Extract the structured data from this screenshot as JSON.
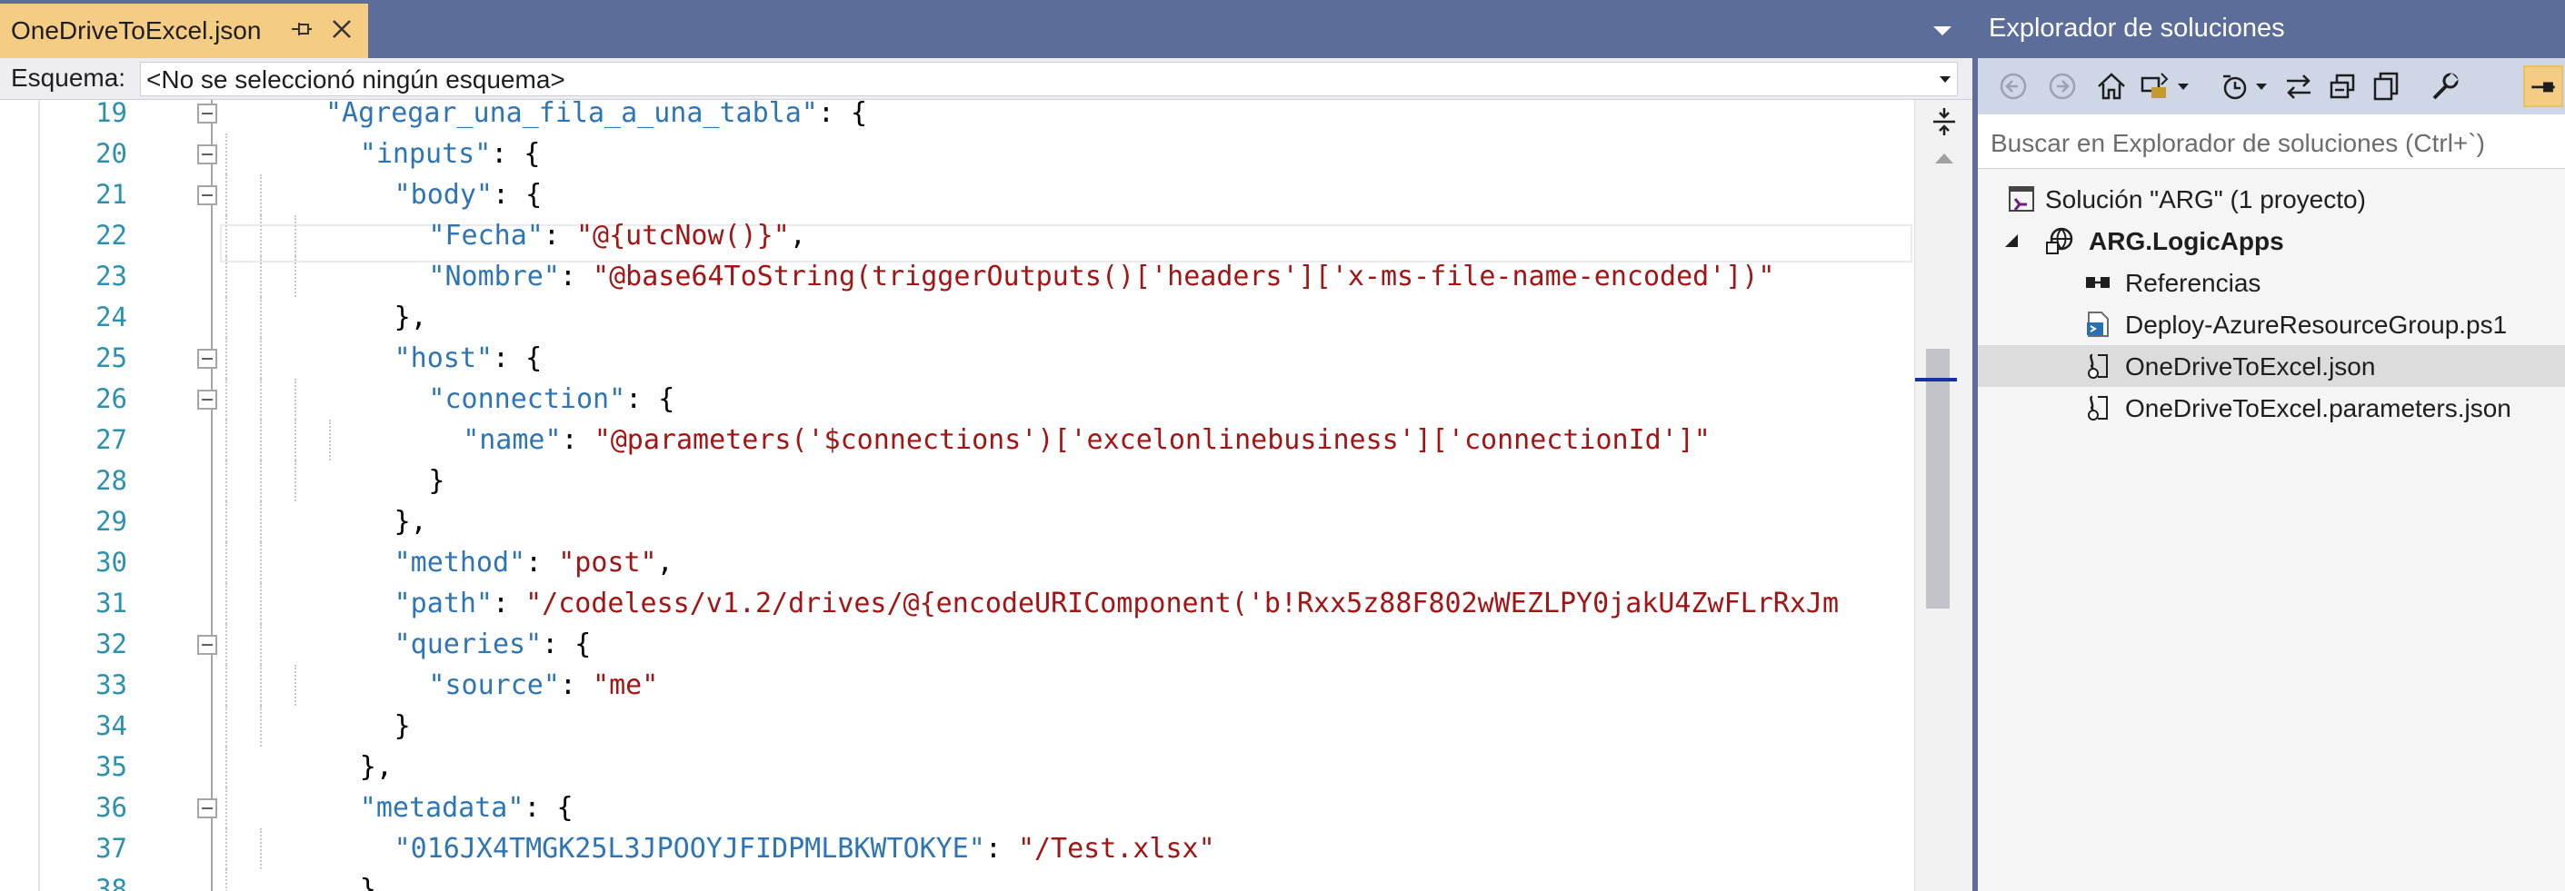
{
  "editor": {
    "tab": {
      "title": "OneDriveToExcel.json"
    },
    "schema": {
      "label": "Esquema:",
      "value": "<No se seleccionó ningún esquema>"
    },
    "lines": [
      {
        "number": "19",
        "tokens": [
          {
            "t": "k",
            "v": "\"Agregar_una_fila_a_una_tabla\""
          },
          {
            "t": "p",
            "v": ": {"
          }
        ]
      },
      {
        "number": "20",
        "tokens": [
          {
            "t": "k",
            "v": "\"inputs\""
          },
          {
            "t": "p",
            "v": ": {"
          }
        ]
      },
      {
        "number": "21",
        "tokens": [
          {
            "t": "k",
            "v": "\"body\""
          },
          {
            "t": "p",
            "v": ": {"
          }
        ]
      },
      {
        "number": "22",
        "tokens": [
          {
            "t": "k",
            "v": "\"Fecha\""
          },
          {
            "t": "p",
            "v": ": "
          },
          {
            "t": "s",
            "v": "\"@{utcNow()}\""
          },
          {
            "t": "p",
            "v": ","
          }
        ]
      },
      {
        "number": "23",
        "tokens": [
          {
            "t": "k",
            "v": "\"Nombre\""
          },
          {
            "t": "p",
            "v": ": "
          },
          {
            "t": "s",
            "v": "\"@base64ToString(triggerOutputs()['headers']['x-ms-file-name-encoded'])\""
          }
        ]
      },
      {
        "number": "24",
        "tokens": [
          {
            "t": "p",
            "v": "},"
          }
        ]
      },
      {
        "number": "25",
        "tokens": [
          {
            "t": "k",
            "v": "\"host\""
          },
          {
            "t": "p",
            "v": ": {"
          }
        ]
      },
      {
        "number": "26",
        "tokens": [
          {
            "t": "k",
            "v": "\"connection\""
          },
          {
            "t": "p",
            "v": ": {"
          }
        ]
      },
      {
        "number": "27",
        "tokens": [
          {
            "t": "k",
            "v": "\"name\""
          },
          {
            "t": "p",
            "v": ": "
          },
          {
            "t": "s",
            "v": "\"@parameters('$connections')['excelonlinebusiness']['connectionId']\""
          }
        ]
      },
      {
        "number": "28",
        "tokens": [
          {
            "t": "p",
            "v": "}"
          }
        ]
      },
      {
        "number": "29",
        "tokens": [
          {
            "t": "p",
            "v": "},"
          }
        ]
      },
      {
        "number": "30",
        "tokens": [
          {
            "t": "k",
            "v": "\"method\""
          },
          {
            "t": "p",
            "v": ": "
          },
          {
            "t": "s",
            "v": "\"post\""
          },
          {
            "t": "p",
            "v": ","
          }
        ]
      },
      {
        "number": "31",
        "tokens": [
          {
            "t": "k",
            "v": "\"path\""
          },
          {
            "t": "p",
            "v": ": "
          },
          {
            "t": "s",
            "v": "\"/codeless/v1.2/drives/@{encodeURIComponent('b!Rxx5z88F802wWEZLPY0jakU4ZwFLrRxJm"
          }
        ]
      },
      {
        "number": "32",
        "tokens": [
          {
            "t": "k",
            "v": "\"queries\""
          },
          {
            "t": "p",
            "v": ": {"
          }
        ]
      },
      {
        "number": "33",
        "tokens": [
          {
            "t": "k",
            "v": "\"source\""
          },
          {
            "t": "p",
            "v": ": "
          },
          {
            "t": "s",
            "v": "\"me\""
          }
        ]
      },
      {
        "number": "34",
        "tokens": [
          {
            "t": "p",
            "v": "}"
          }
        ]
      },
      {
        "number": "35",
        "tokens": [
          {
            "t": "p",
            "v": "},"
          }
        ]
      },
      {
        "number": "36",
        "tokens": [
          {
            "t": "k",
            "v": "\"metadata\""
          },
          {
            "t": "p",
            "v": ": {"
          }
        ]
      },
      {
        "number": "37",
        "tokens": [
          {
            "t": "k",
            "v": "\"016JX4TMGK25L3JPOOYJFIDPMLBKWTOKYE\""
          },
          {
            "t": "p",
            "v": ": "
          },
          {
            "t": "s",
            "v": "\"/Test.xlsx\""
          }
        ]
      },
      {
        "number": "38",
        "tokens": [
          {
            "t": "p",
            "v": "},"
          }
        ]
      }
    ]
  },
  "explorer": {
    "title": "Explorador de soluciones",
    "search_placeholder": "Buscar en Explorador de soluciones (Ctrl+`)",
    "toolbar_icons": [
      "back-icon",
      "forward-icon",
      "home-icon",
      "switch-views-icon",
      "dropdown-arrow-icon",
      "pending-changes-icon",
      "dropdown-arrow-icon",
      "sync-icon",
      "collapse-all-icon",
      "show-all-files-icon",
      "properties-wrench-icon",
      "preview-selected-icon"
    ],
    "tree": [
      {
        "label": "Solución \"ARG\"  (1 proyecto)",
        "icon": "solution-icon",
        "bold": false,
        "selected": false
      },
      {
        "label": "ARG.LogicApps",
        "icon": "project-icon",
        "bold": true,
        "selected": false
      },
      {
        "label": "Referencias",
        "icon": "references-icon",
        "bold": false,
        "selected": false
      },
      {
        "label": "Deploy-AzureResourceGroup.ps1",
        "icon": "powershell-file-icon",
        "bold": false,
        "selected": false
      },
      {
        "label": "OneDriveToExcel.json",
        "icon": "json-file-icon",
        "bold": false,
        "selected": true
      },
      {
        "label": "OneDriveToExcel.parameters.json",
        "icon": "json-file-icon",
        "bold": false,
        "selected": false
      }
    ]
  },
  "colors": {
    "title_bar": "#5c6d99",
    "active_tab": "#f5cc84",
    "json_key": "#2e75b6",
    "json_string": "#a31515",
    "line_number": "#2b91af",
    "selection": "#dcdcdc"
  }
}
